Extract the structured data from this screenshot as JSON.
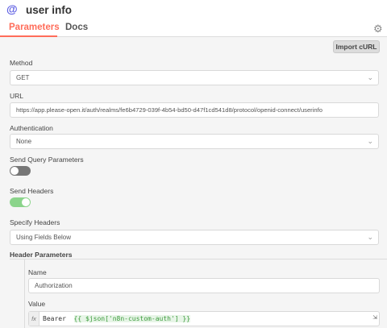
{
  "header": {
    "icon": "@",
    "title": "user info"
  },
  "tabs": [
    {
      "label": "Parameters",
      "active": true
    },
    {
      "label": "Docs",
      "active": false
    }
  ],
  "toolbar": {
    "import_label": "Import cURL"
  },
  "fields": {
    "method": {
      "label": "Method",
      "value": "GET"
    },
    "url": {
      "label": "URL",
      "value": "https://app.please-open.it/auth/realms/fe6b4729-039f-4b54-bd50-d47f1cd541d8/protocol/openid-connect/userinfo"
    },
    "authentication": {
      "label": "Authentication",
      "value": "None"
    },
    "send_query": {
      "label": "Send Query Parameters",
      "enabled": false
    },
    "send_headers": {
      "label": "Send Headers",
      "enabled": true
    },
    "specify_headers": {
      "label": "Specify Headers",
      "value": "Using Fields Below"
    }
  },
  "header_parameters": {
    "title": "Header Parameters",
    "name_label": "Name",
    "name_value": "Authorization",
    "value_label": "Value",
    "value_prefix": "fx",
    "value_text": "Bearer ",
    "value_expression": "{{ $json['n8n-custom-auth'] }}"
  },
  "colors": {
    "accent": "#ff6d5a",
    "toggle_on": "#8bd48b",
    "toggle_off": "#777777",
    "expression_bg": "#e7f5e7"
  }
}
